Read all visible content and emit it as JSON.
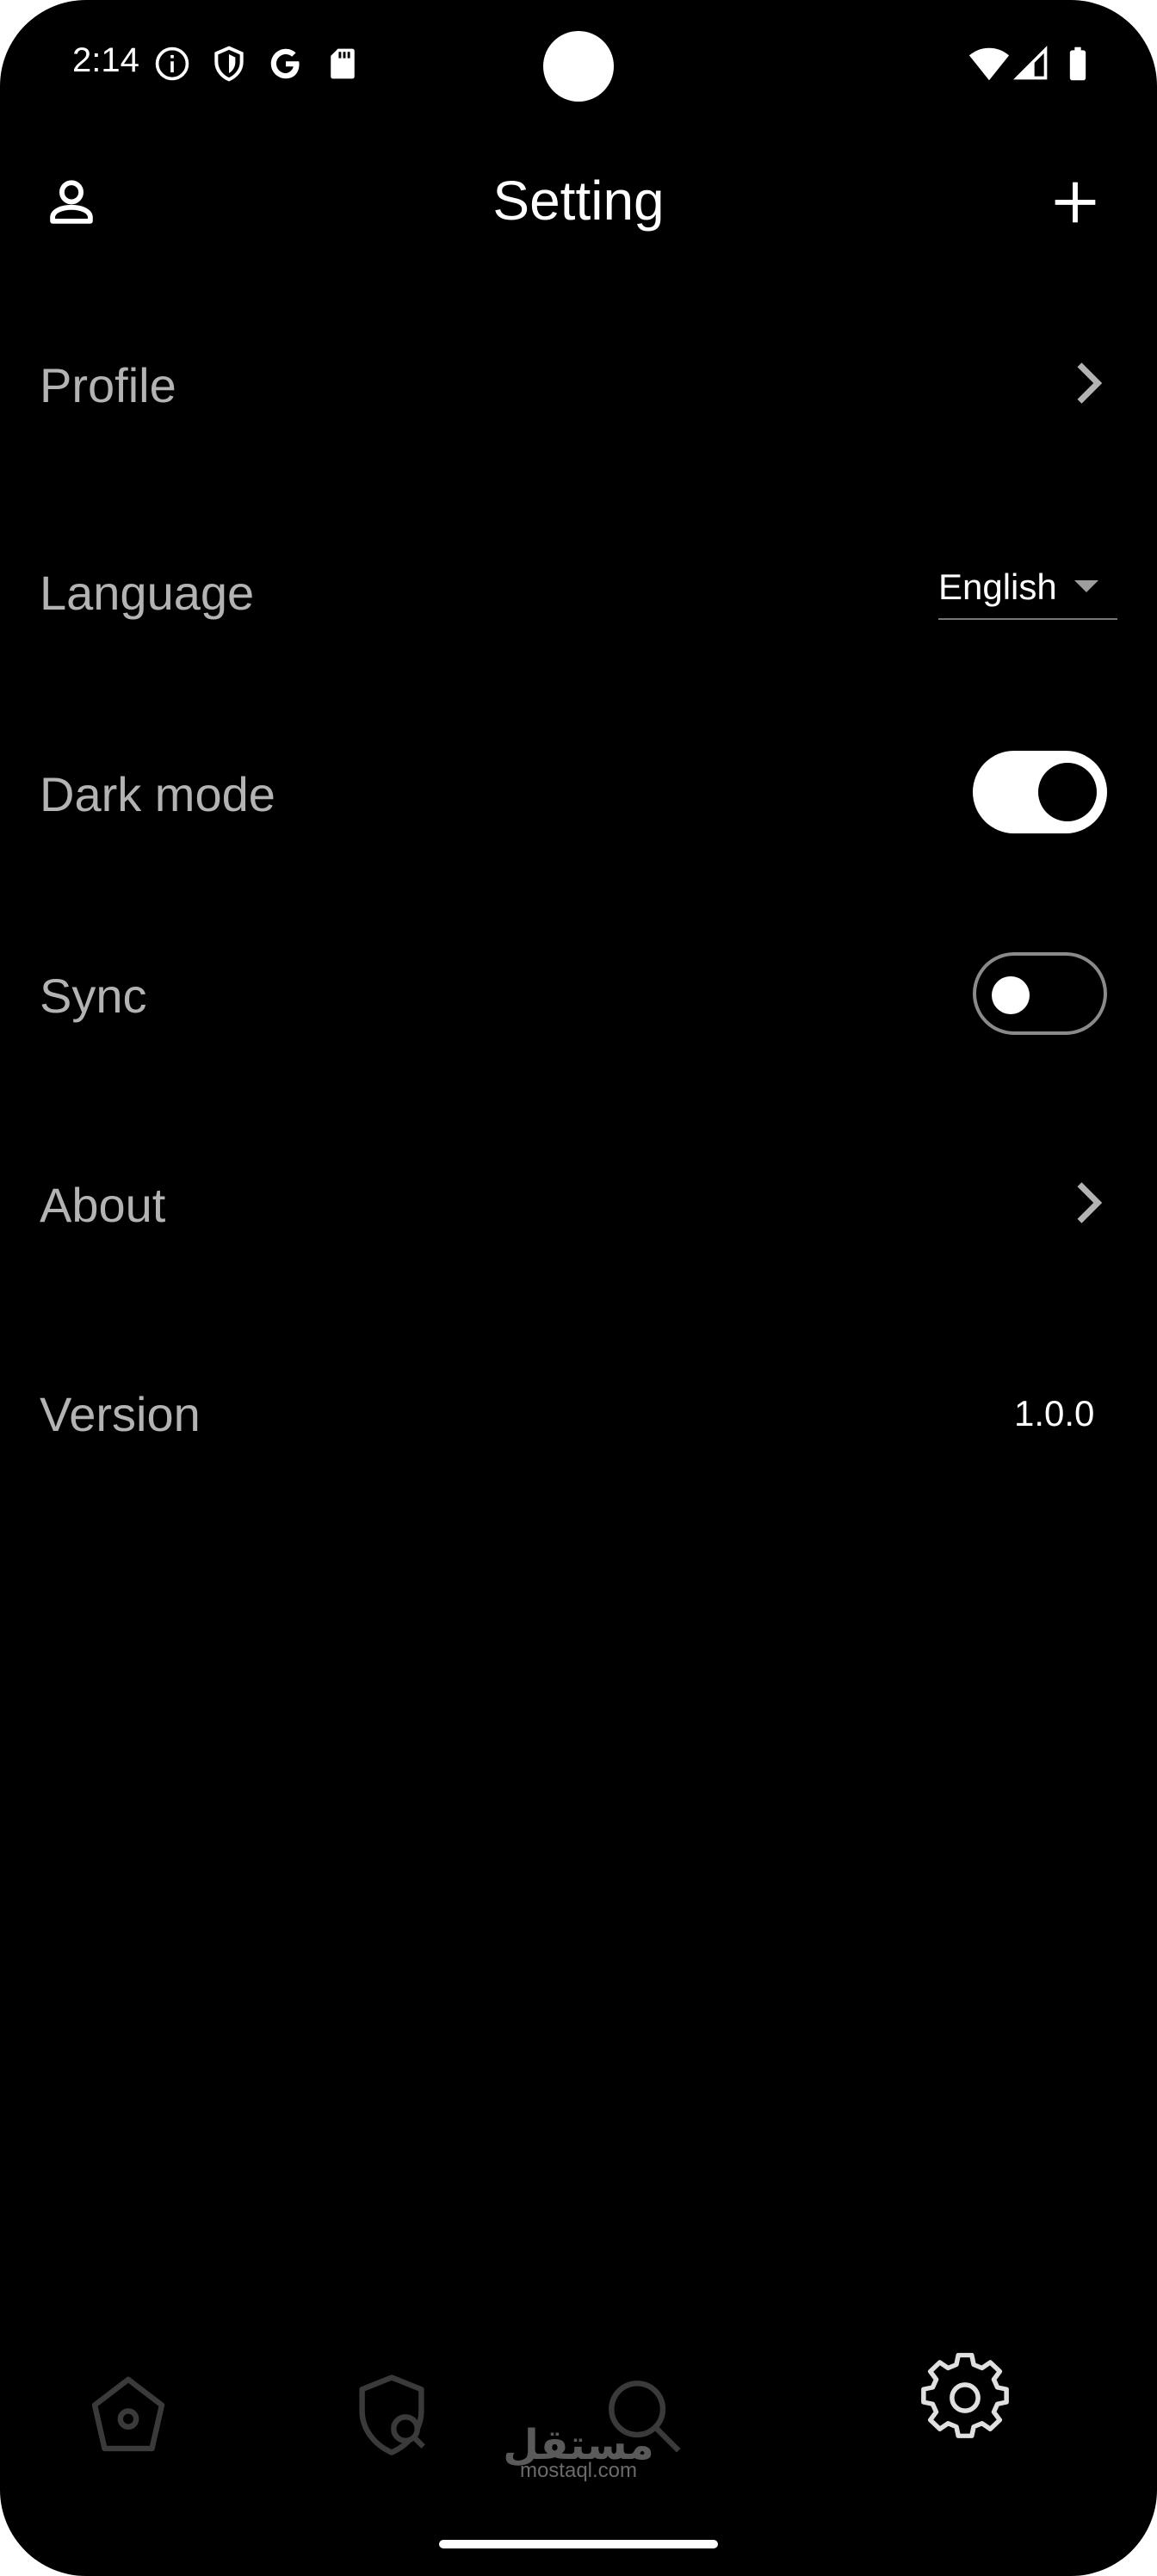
{
  "status_bar": {
    "time": "2:14",
    "icons": [
      "info-icon",
      "shield-icon",
      "google-icon",
      "sd-card-icon",
      "wifi-icon",
      "signal-icon",
      "battery-icon"
    ]
  },
  "app_bar": {
    "title": "Setting",
    "left_icon": "person-icon",
    "right_icon": "plus-icon"
  },
  "settings": {
    "profile": {
      "label": "Profile"
    },
    "language": {
      "label": "Language",
      "value": "English"
    },
    "dark_mode": {
      "label": "Dark mode",
      "enabled": true
    },
    "sync": {
      "label": "Sync",
      "enabled": false
    },
    "about": {
      "label": "About"
    },
    "version": {
      "label": "Version",
      "value": "1.0.0"
    }
  },
  "bottom_nav": {
    "items": [
      {
        "icon": "home-icon",
        "active": false
      },
      {
        "icon": "shield-search-icon",
        "active": false
      },
      {
        "icon": "search-icon",
        "active": false
      },
      {
        "icon": "gear-icon",
        "active": true
      }
    ]
  },
  "watermark": {
    "arabic": "مستقل",
    "latin": "mostaql.com"
  },
  "colors": {
    "background": "#000000",
    "label": "#b3b3b3",
    "text": "#ffffff",
    "inactive_icon": "#3a3a3a"
  }
}
